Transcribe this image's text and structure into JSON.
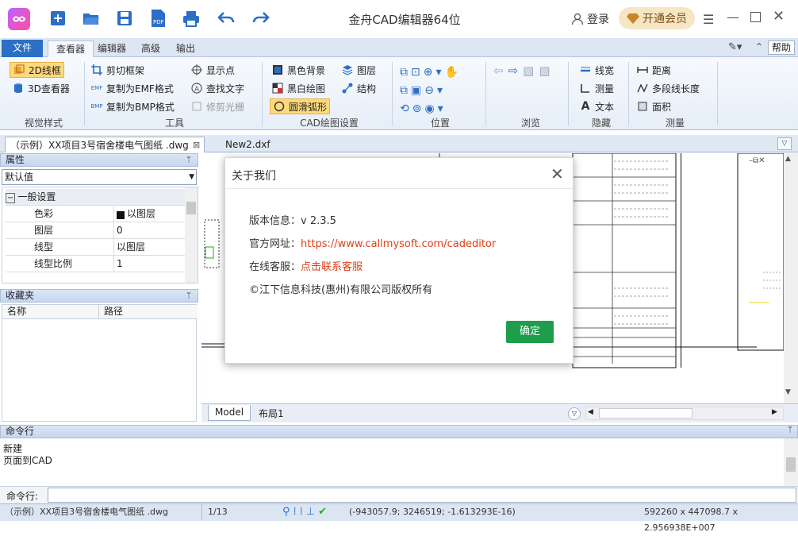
{
  "app": {
    "title": "金舟CAD编辑器64位",
    "login": "登录",
    "vip": "开通会员",
    "help": "帮助"
  },
  "ribbon_tabs": [
    "文件",
    "查看器",
    "编辑器",
    "高级",
    "输出"
  ],
  "ribbon": {
    "view_style": {
      "items": [
        "2D线框",
        "3D查看器"
      ],
      "label": "视觉样式"
    },
    "tools": {
      "items": [
        "剪切框架",
        "复制为EMF格式",
        "复制为BMP格式",
        "显示点",
        "查找文字",
        "修剪光栅"
      ],
      "label": "工具"
    },
    "cad_settings": {
      "items": [
        "黑色背景",
        "黑白绘图",
        "圆滑弧形",
        "图层",
        "结构"
      ],
      "label": "CAD绘图设置"
    },
    "position": {
      "label": "位置"
    },
    "browse": {
      "label": "浏览"
    },
    "hide": {
      "items": [
        "线宽",
        "测量",
        "文本"
      ],
      "label": "隐藏"
    },
    "measure": {
      "items": [
        "距离",
        "多段线长度",
        "面积"
      ],
      "label": "测量"
    }
  },
  "doc_tabs": [
    "（示例）XX项目3号宿舍楼电气图纸 .dwg",
    "New2.dxf"
  ],
  "properties": {
    "header": "属性",
    "dropdown": "默认值",
    "section": "一般设置",
    "rows": [
      {
        "name": "色彩",
        "value": "以图层"
      },
      {
        "name": "图层",
        "value": "0"
      },
      {
        "name": "线型",
        "value": "以图层"
      },
      {
        "name": "线型比例",
        "value": "1"
      }
    ]
  },
  "favorites": {
    "header": "收藏夹",
    "col_name": "名称",
    "col_path": "路径"
  },
  "layout_tabs": [
    "Model",
    "布局1"
  ],
  "command": {
    "header": "命令行",
    "lines": [
      "新建",
      "页面到CAD"
    ],
    "prompt": "命令行:"
  },
  "status": {
    "file": "（示例）XX项目3号宿舍楼电气图纸 .dwg",
    "page": "1/13",
    "coords": "(-943057.9; 3246519; -1.613293E-16)",
    "size": "592260 x 447098.7 x 2.956938E+007"
  },
  "dialog": {
    "title": "关于我们",
    "version_label": "版本信息：",
    "version": "v 2.3.5",
    "site_label": "官方网址：",
    "site": "https://www.callmysoft.com/cadeditor",
    "support_label": "在线客服：",
    "support": "点击联系客服",
    "copyright": "©江下信息科技(惠州)有限公司版权所有",
    "ok": "确定"
  },
  "colors": {
    "accent": "#2b6fc6",
    "ok_button": "#1e9e4a",
    "link": "#e0401b",
    "vip_bg": "#f6e6c4"
  }
}
